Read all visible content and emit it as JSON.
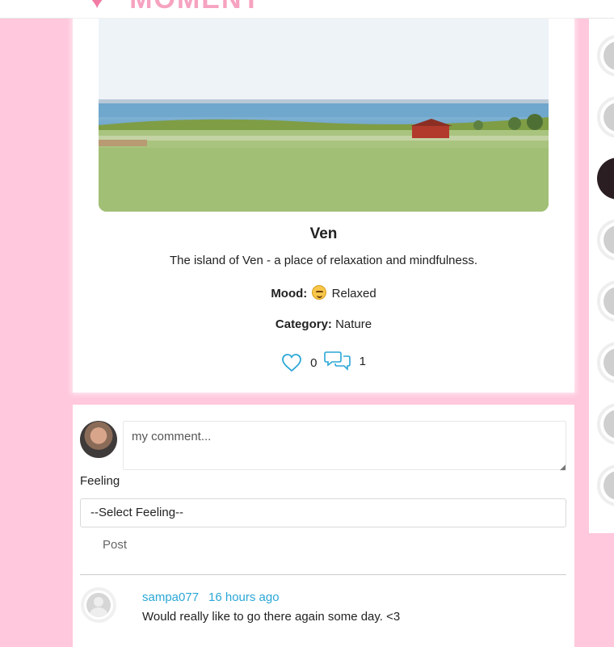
{
  "header": {
    "brand_name": "MOMENT"
  },
  "post": {
    "title": "Ven",
    "description": "The island of Ven - a place of relaxation and mindfulness.",
    "mood_label": "Mood:",
    "mood_value": "Relaxed",
    "category_label": "Category:",
    "category_value": "Nature",
    "likes": "0",
    "comments": "1",
    "image_icon": "landscape-photo"
  },
  "comment_form": {
    "placeholder": "my comment...",
    "feeling_label": "Feeling",
    "feeling_selected": "--Select Feeling--",
    "submit_label": "Post"
  },
  "comments": [
    {
      "username": "sampa077",
      "time": "16 hours ago",
      "text": "Would really like to go there again some day. <3"
    }
  ],
  "colors": {
    "background": "#ffc8dc",
    "link": "#2aa7d6",
    "icon": "#2aa7d6"
  }
}
